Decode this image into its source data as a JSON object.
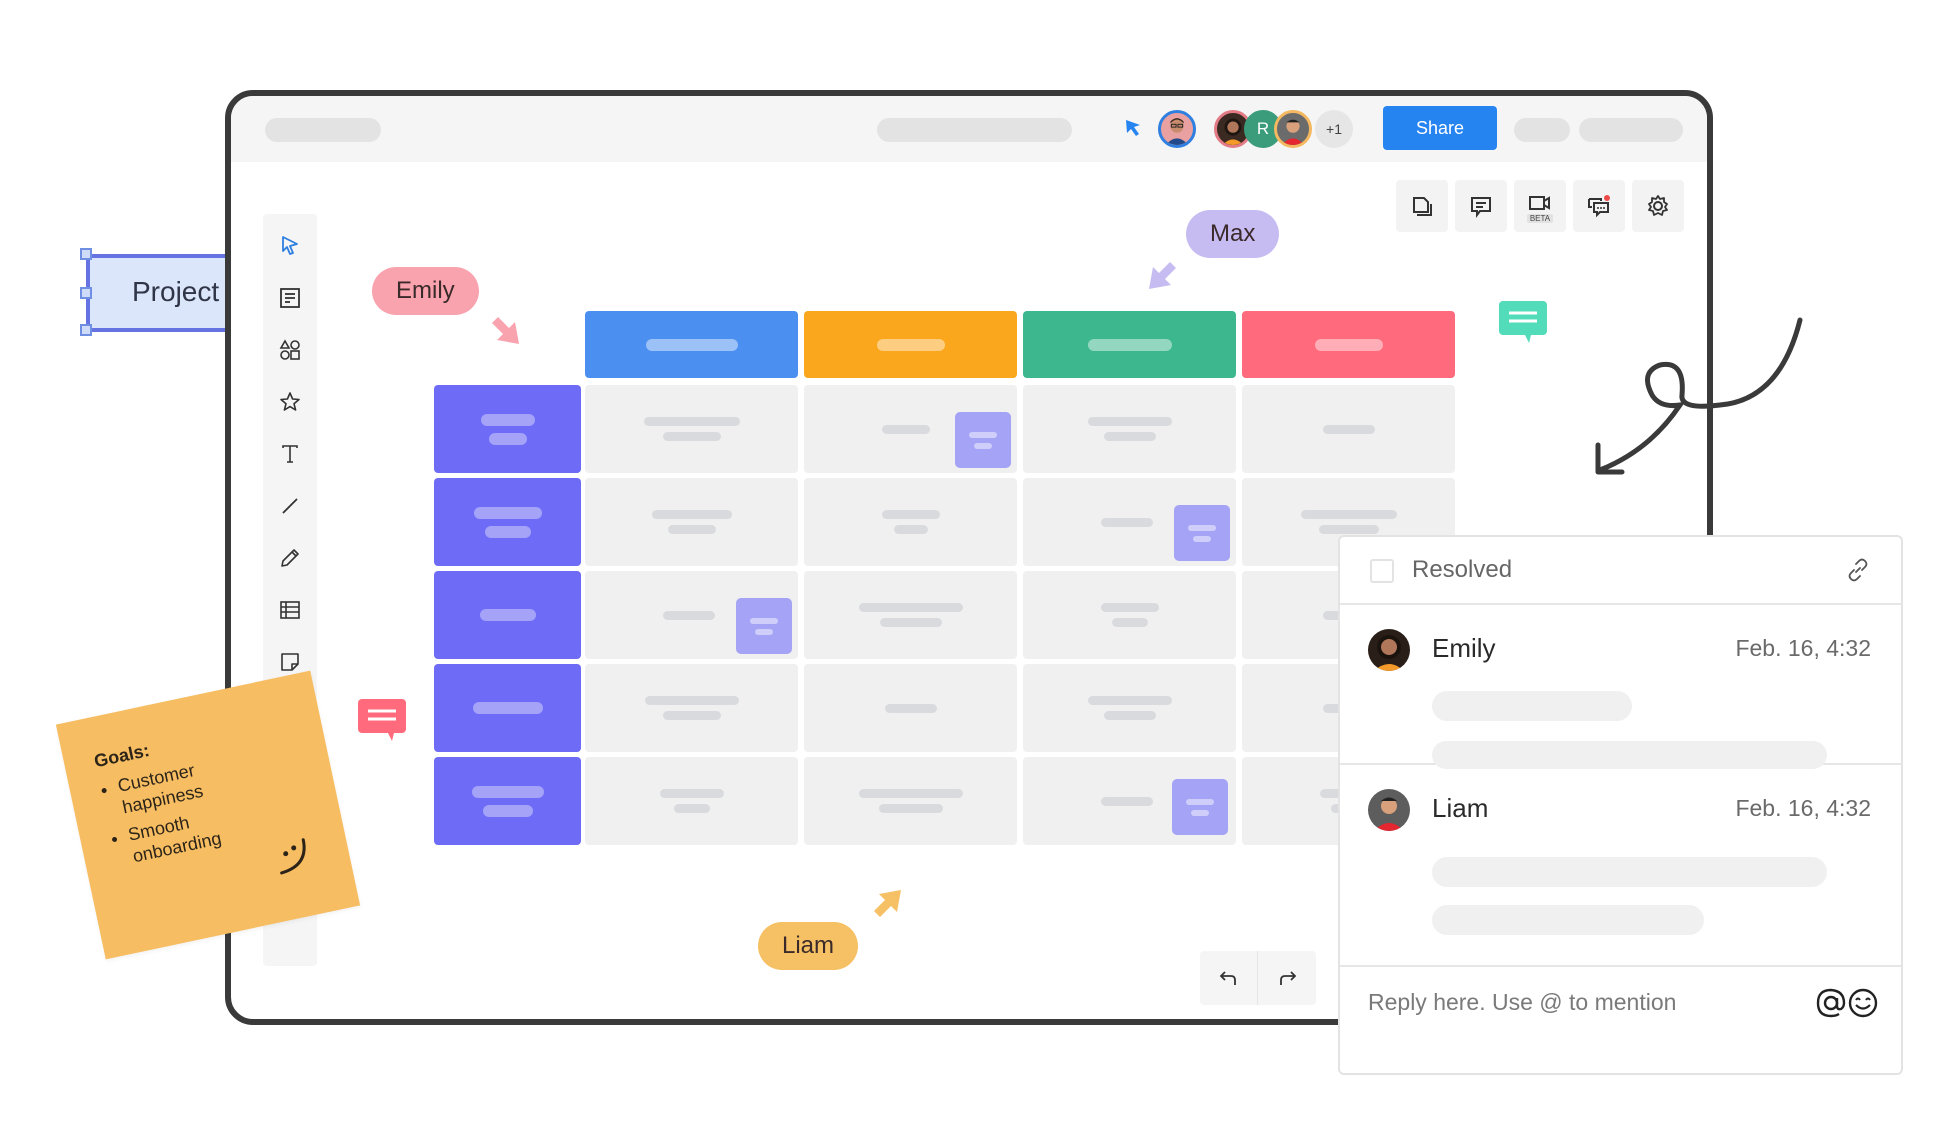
{
  "topbar": {
    "share_label": "Share",
    "collaborators": [
      {
        "name": "Cursor user",
        "initial": "",
        "ring": "#2e7fe0"
      },
      {
        "name": "Emily",
        "initial": "",
        "ring": "#e37b86"
      },
      {
        "name": "R",
        "initial": "R",
        "ring": "#3a9c7a"
      },
      {
        "name": "Liam",
        "initial": "",
        "ring": "#f4b860"
      }
    ],
    "more_count": "+1"
  },
  "toolbar_right": {
    "buttons": [
      {
        "name": "pages",
        "icon": "pages-icon"
      },
      {
        "name": "comments",
        "icon": "comment-icon"
      },
      {
        "name": "video",
        "icon": "video-icon",
        "badge": "BETA"
      },
      {
        "name": "chat",
        "icon": "chat-icon",
        "notification": true
      },
      {
        "name": "settings",
        "icon": "gear-icon"
      }
    ]
  },
  "tools": [
    {
      "name": "select",
      "icon": "cursor-icon"
    },
    {
      "name": "templates",
      "icon": "template-icon"
    },
    {
      "name": "shapes",
      "icon": "shapes-icon"
    },
    {
      "name": "favorites",
      "icon": "star-icon"
    },
    {
      "name": "text",
      "icon": "text-icon"
    },
    {
      "name": "line",
      "icon": "line-icon"
    },
    {
      "name": "pen",
      "icon": "pencil-icon"
    },
    {
      "name": "table",
      "icon": "table-icon"
    },
    {
      "name": "sticky-note",
      "icon": "sticky-note-icon"
    }
  ],
  "board": {
    "column_colors": [
      "#4b8ff1",
      "#fba71d",
      "#3cb78e",
      "#ff6b7c"
    ],
    "row_label_color": "#6e6cf6",
    "rows": 5,
    "columns": 4
  },
  "cursors": [
    {
      "name": "Emily",
      "color": "#f9a3ae"
    },
    {
      "name": "Max",
      "color": "#c7bcf1"
    },
    {
      "name": "Liam",
      "color": "#f6c064"
    }
  ],
  "project_label": "Project",
  "sticky_note": {
    "title": "Goals:",
    "items": [
      "Customer happiness",
      "Smooth onboarding"
    ]
  },
  "history": {
    "undo": "undo-icon",
    "redo": "redo-icon"
  },
  "comment_panel": {
    "resolved_label": "Resolved",
    "comments": [
      {
        "author": "Emily",
        "time": "Feb. 16, 4:32"
      },
      {
        "author": "Liam",
        "time": "Feb. 16, 4:32"
      }
    ],
    "reply_placeholder": "Reply here. Use @ to mention"
  }
}
